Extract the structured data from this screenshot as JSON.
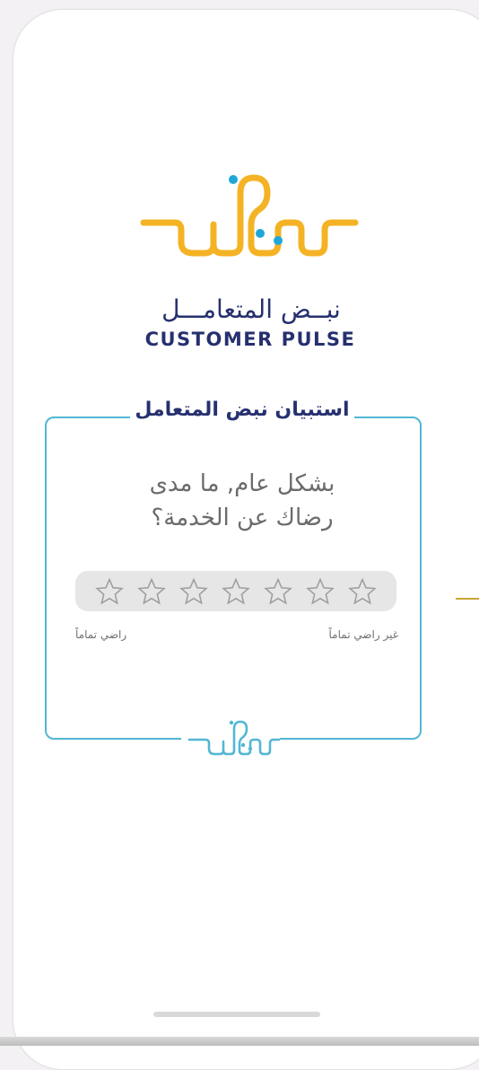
{
  "brand": {
    "arabic_name": "نبــض المتعامـــل",
    "english_name": "CUSTOMER PULSE",
    "logo_icon": "customer-pulse-logo-icon"
  },
  "survey": {
    "title": "استبيان نبض المتعامل",
    "question_line1": "بشكل عام, ما مدى",
    "question_line2": "رضاك عن الخدمة؟",
    "rating_stars": 7,
    "selected_rating": 0,
    "label_left": "راضي تماماً",
    "label_right": "غير راضي تماماً"
  },
  "colors": {
    "brand_navy": "#26306f",
    "logo_yellow": "#f4b324",
    "logo_dot_blue": "#1fa7d8",
    "card_border": "#52b7d4",
    "star_outline": "#9e9e9e",
    "rating_bar_bg": "#e6e6e6"
  }
}
